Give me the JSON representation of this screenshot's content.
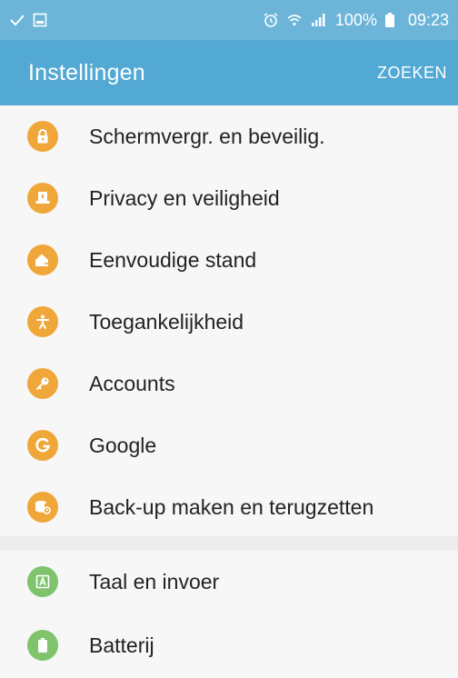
{
  "status_bar": {
    "battery_text": "100%",
    "time": "09:23",
    "icons_left": [
      "check-icon",
      "image-icon"
    ],
    "icons_right": [
      "alarm-icon",
      "wifi-icon",
      "signal-icon",
      "battery-icon"
    ]
  },
  "header": {
    "title": "Instellingen",
    "search_label": "ZOEKEN"
  },
  "colors": {
    "status_bar": "#6cb5d9",
    "app_bar": "#52a9d4",
    "orange": "#f0a73a",
    "green": "#7fc46c"
  },
  "settings": {
    "group1": [
      {
        "label": "Schermvergr. en beveilig.",
        "icon": "lock-icon"
      },
      {
        "label": "Privacy en veiligheid",
        "icon": "privacy-icon"
      },
      {
        "label": "Eenvoudige stand",
        "icon": "home-icon"
      },
      {
        "label": "Toegankelijkheid",
        "icon": "accessibility-icon"
      },
      {
        "label": "Accounts",
        "icon": "key-icon"
      },
      {
        "label": "Google",
        "icon": "google-icon"
      },
      {
        "label": "Back-up maken en terugzetten",
        "icon": "backup-icon"
      }
    ],
    "group2": [
      {
        "label": "Taal en invoer",
        "icon": "language-icon"
      },
      {
        "label": "Batterij",
        "icon": "battery-icon"
      }
    ]
  }
}
